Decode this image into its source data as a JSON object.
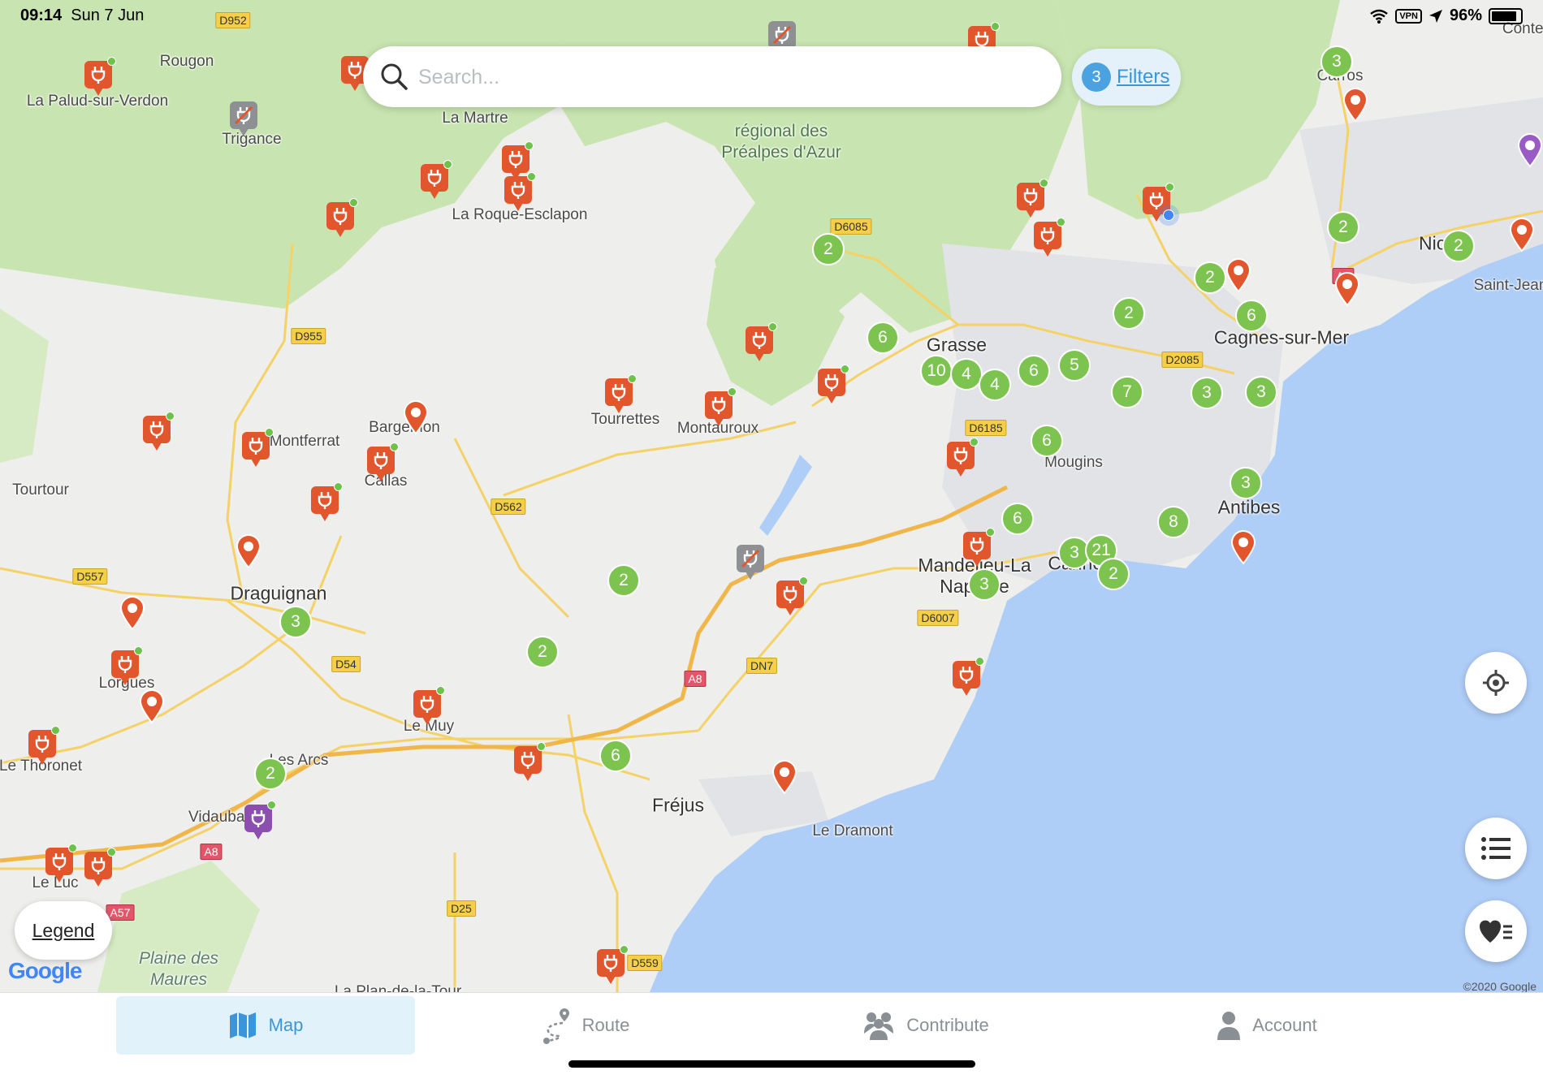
{
  "status_bar": {
    "time": "09:14",
    "date": "Sun 7 Jun",
    "vpn": "VPN",
    "battery": "96%"
  },
  "search": {
    "placeholder": "Search..."
  },
  "filters": {
    "count": "3",
    "label": "Filters"
  },
  "legend": {
    "label": "Legend"
  },
  "map": {
    "places": [
      "Rougon",
      "La Palud-sur-Verdon",
      "Trigance",
      "La Martre",
      "régional des Préalpes d'Azur",
      "La Roque-Esclapon",
      "Grasse",
      "Cagnes-sur-Mer",
      "Tourrettes",
      "Montauroux",
      "Bargemon",
      "Montferrat",
      "Callas",
      "Tourtour",
      "Mougins",
      "Antibes",
      "Draguignan",
      "Mandelieu-La Napoule",
      "Lorgues",
      "Le Muy",
      "Les Arcs",
      "Le Thoronet",
      "Vidauban",
      "Fréjus",
      "Le Dramont",
      "Le Luc",
      "Plaine des Maures",
      "Saint-Jean",
      "Nice",
      "Carros",
      "Contes",
      "La Plan-de-la-Tour",
      "Cannes"
    ],
    "roads": [
      "D952",
      "D6085",
      "D955",
      "D2085",
      "D6185",
      "D562",
      "D557",
      "D6007",
      "D54",
      "A8",
      "DN7",
      "A57",
      "D25",
      "D559",
      "A8",
      "A8"
    ],
    "clusters": [
      "3",
      "2",
      "2",
      "6",
      "10",
      "4",
      "4",
      "6",
      "5",
      "7",
      "3",
      "3",
      "2",
      "6",
      "2",
      "2",
      "6",
      "3",
      "8",
      "6",
      "3",
      "21",
      "3",
      "2",
      "2",
      "2",
      "3",
      "6",
      "2"
    ],
    "attribution": "Google",
    "copyright": "©2020 Google"
  },
  "tabs": [
    {
      "label": "Map",
      "icon": "map-icon"
    },
    {
      "label": "Route",
      "icon": "route-icon"
    },
    {
      "label": "Contribute",
      "icon": "contribute-icon"
    },
    {
      "label": "Account",
      "icon": "account-icon"
    }
  ],
  "colors": {
    "accent": "#3a96d9",
    "cluster": "#7cc44f",
    "charger": "#e2562d",
    "sea": "#aecdf7",
    "forest": "#c8e4b0"
  }
}
